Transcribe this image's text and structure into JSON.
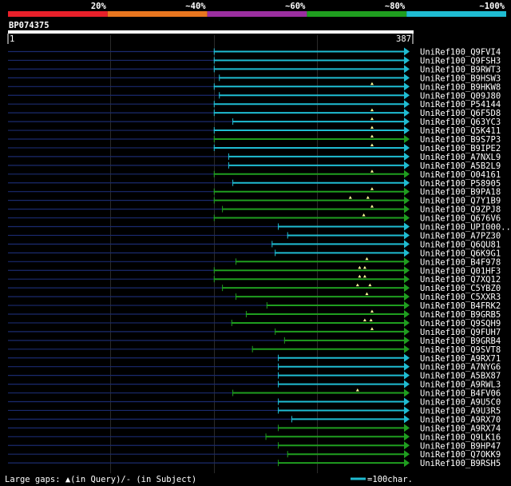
{
  "query": {
    "id": "BP074375",
    "start_label": "1",
    "end_label": "387",
    "length": 387
  },
  "identity_legend": {
    "segments": [
      {
        "label": "20%",
        "color": "#e8202a"
      },
      {
        "label": "~40%",
        "color": "#e8761f"
      },
      {
        "label": "~60%",
        "color": "#9b2fa0"
      },
      {
        "label": "~80%",
        "color": "#1f9e1f"
      },
      {
        "label": "~100%",
        "color": "#1fbcd2"
      }
    ]
  },
  "footer": {
    "gap_note": "Large gaps: ▲(in Query)/- (in Subject)",
    "scale_label": "=100char."
  },
  "colors": {
    "background": "#000000",
    "axis": "#ffffff",
    "grid": "#2a2a2a",
    "unaligned": "#1a2a6e",
    "high_identity": "#1fbcd2",
    "mid_identity": "#1f9e1f",
    "gap_marker": "#ffff99"
  },
  "chart_data": {
    "type": "alignment-overview",
    "x_unit": "query residue",
    "xlim": [
      1,
      387
    ],
    "hits": [
      {
        "name": "UniRef100_Q9FVI4",
        "start": 200,
        "identity": "~100%",
        "gaps": []
      },
      {
        "name": "UniRef100_Q9FSH3",
        "start": 200,
        "identity": "~100%",
        "gaps": []
      },
      {
        "name": "UniRef100_B9RWT3",
        "start": 200,
        "identity": "~100%",
        "gaps": []
      },
      {
        "name": "UniRef100_B9HSW3",
        "start": 205,
        "identity": "~100%",
        "gaps": []
      },
      {
        "name": "UniRef100_B9HKW8",
        "start": 200,
        "identity": "~100%",
        "gaps": [
          353
        ]
      },
      {
        "name": "UniRef100_Q09J80",
        "start": 205,
        "identity": "~100%",
        "gaps": []
      },
      {
        "name": "UniRef100_P54144",
        "start": 200,
        "identity": "~100%",
        "gaps": []
      },
      {
        "name": "UniRef100_Q6F5D8",
        "start": 200,
        "identity": "~100%",
        "gaps": [
          353
        ]
      },
      {
        "name": "UniRef100_Q63YC3",
        "start": 218,
        "identity": "~100%",
        "gaps": [
          353
        ]
      },
      {
        "name": "UniRef100_Q5K411",
        "start": 200,
        "identity": "~100%",
        "gaps": [
          353
        ]
      },
      {
        "name": "UniRef100_B9S7P3",
        "start": 200,
        "identity": "~80%",
        "gaps": [
          353
        ]
      },
      {
        "name": "UniRef100_B9IPE2",
        "start": 200,
        "identity": "~100%",
        "gaps": [
          353
        ]
      },
      {
        "name": "UniRef100_A7NXL9",
        "start": 214,
        "identity": "~100%",
        "gaps": []
      },
      {
        "name": "UniRef100_A5B2L9",
        "start": 214,
        "identity": "~100%",
        "gaps": []
      },
      {
        "name": "UniRef100_O04161",
        "start": 200,
        "identity": "~80%",
        "gaps": [
          353
        ]
      },
      {
        "name": "UniRef100_P58905",
        "start": 218,
        "identity": "~100%",
        "gaps": []
      },
      {
        "name": "UniRef100_B9PA18",
        "start": 200,
        "identity": "~80%",
        "gaps": [
          353
        ]
      },
      {
        "name": "UniRef100_Q7Y1B9",
        "start": 200,
        "identity": "~80%",
        "gaps": [
          332,
          349
        ]
      },
      {
        "name": "UniRef100_Q9ZPJ8",
        "start": 208,
        "identity": "~80%",
        "gaps": [
          353
        ]
      },
      {
        "name": "UniRef100_Q676V6",
        "start": 200,
        "identity": "~80%",
        "gaps": [
          345
        ]
      },
      {
        "name": "UniRef100_UPI000..",
        "start": 262,
        "identity": "~100%",
        "gaps": []
      },
      {
        "name": "UniRef100_A7PZ30",
        "start": 271,
        "identity": "~100%",
        "gaps": []
      },
      {
        "name": "UniRef100_Q6QU81",
        "start": 256,
        "identity": "~100%",
        "gaps": []
      },
      {
        "name": "UniRef100_Q6K9G1",
        "start": 259,
        "identity": "~100%",
        "gaps": []
      },
      {
        "name": "UniRef100_B4F978",
        "start": 221,
        "identity": "~80%",
        "gaps": [
          348
        ]
      },
      {
        "name": "UniRef100_Q01HF3",
        "start": 200,
        "identity": "~80%",
        "gaps": [
          341,
          346
        ]
      },
      {
        "name": "UniRef100_Q7XQ12",
        "start": 200,
        "identity": "~80%",
        "gaps": [
          341,
          346
        ]
      },
      {
        "name": "UniRef100_C5YBZ0",
        "start": 208,
        "identity": "~80%",
        "gaps": [
          339,
          351
        ]
      },
      {
        "name": "UniRef100_C5XXR3",
        "start": 221,
        "identity": "~80%",
        "gaps": [
          348
        ]
      },
      {
        "name": "UniRef100_B4FRK2",
        "start": 251,
        "identity": "~80%",
        "gaps": []
      },
      {
        "name": "UniRef100_B9GRB5",
        "start": 231,
        "identity": "~80%",
        "gaps": [
          353
        ]
      },
      {
        "name": "UniRef100_Q9SQH9",
        "start": 217,
        "identity": "~80%",
        "gaps": [
          346,
          352
        ]
      },
      {
        "name": "UniRef100_Q9FUH7",
        "start": 259,
        "identity": "~80%",
        "gaps": [
          353
        ]
      },
      {
        "name": "UniRef100_B9GRB4",
        "start": 268,
        "identity": "~80%",
        "gaps": []
      },
      {
        "name": "UniRef100_Q9SVT8",
        "start": 237,
        "identity": "~80%",
        "gaps": []
      },
      {
        "name": "UniRef100_A9RX71",
        "start": 262,
        "identity": "~100%",
        "gaps": []
      },
      {
        "name": "UniRef100_A7NYG6",
        "start": 262,
        "identity": "~100%",
        "gaps": []
      },
      {
        "name": "UniRef100_A5BX87",
        "start": 262,
        "identity": "~100%",
        "gaps": []
      },
      {
        "name": "UniRef100_A9RWL3",
        "start": 262,
        "identity": "~100%",
        "gaps": []
      },
      {
        "name": "UniRef100_B4FV06",
        "start": 218,
        "identity": "~80%",
        "gaps": [
          339
        ]
      },
      {
        "name": "UniRef100_A9U5C0",
        "start": 262,
        "identity": "~100%",
        "gaps": []
      },
      {
        "name": "UniRef100_A9U3R5",
        "start": 262,
        "identity": "~100%",
        "gaps": []
      },
      {
        "name": "UniRef100_A9RX70",
        "start": 275,
        "identity": "~100%",
        "gaps": []
      },
      {
        "name": "UniRef100_A9RX74",
        "start": 262,
        "identity": "~80%",
        "gaps": []
      },
      {
        "name": "UniRef100_Q9LK16",
        "start": 250,
        "identity": "~80%",
        "gaps": []
      },
      {
        "name": "UniRef100_B9HP47",
        "start": 262,
        "identity": "~80%",
        "gaps": []
      },
      {
        "name": "UniRef100_Q7OKK9",
        "start": 271,
        "identity": "~80%",
        "gaps": []
      },
      {
        "name": "UniRef100_B9RSH5",
        "start": 262,
        "identity": "~80%",
        "gaps": []
      }
    ]
  }
}
